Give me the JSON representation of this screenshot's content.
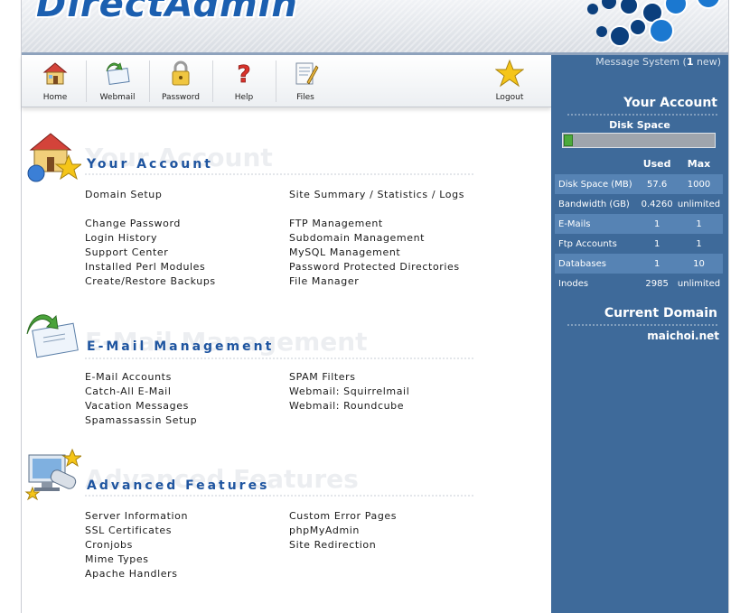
{
  "header": {
    "logo": "DirectAdmin"
  },
  "toolbar": {
    "items": [
      {
        "label": "Home",
        "icon": "home-icon"
      },
      {
        "label": "Webmail",
        "icon": "webmail-icon"
      },
      {
        "label": "Password",
        "icon": "lock-icon"
      },
      {
        "label": "Help",
        "icon": "help-icon"
      },
      {
        "label": "Files",
        "icon": "files-icon"
      },
      {
        "label": "Logout",
        "icon": "star-icon"
      }
    ]
  },
  "sidebar": {
    "message_system": {
      "label": "Message System (",
      "count": "1",
      "suffix": " new)"
    },
    "account_heading": "Your Account",
    "disk_space_label": "Disk Space",
    "disk_usage_fraction": 0.058,
    "columns": {
      "used": "Used",
      "max": "Max"
    },
    "stats": [
      {
        "name": "Disk Space (MB)",
        "used": "57.6",
        "max": "1000"
      },
      {
        "name": "Bandwidth (GB)",
        "used": "0.4260",
        "max": "unlimited"
      },
      {
        "name": "E-Mails",
        "used": "1",
        "max": "1"
      },
      {
        "name": "Ftp Accounts",
        "used": "1",
        "max": "1"
      },
      {
        "name": "Databases",
        "used": "1",
        "max": "10"
      },
      {
        "name": "Inodes",
        "used": "2985",
        "max": "unlimited"
      }
    ],
    "current_domain_heading": "Current Domain",
    "current_domain": "maichoi.net"
  },
  "sections": {
    "account": {
      "title": "Your Account",
      "links_left": [
        "Domain Setup",
        "Change Password",
        "Login History",
        "Support Center",
        "Installed Perl Modules",
        "Create/Restore Backups"
      ],
      "links_right": [
        "Site Summary / Statistics / Logs",
        "FTP Management",
        "Subdomain Management",
        "MySQL Management",
        "Password Protected Directories",
        "File Manager"
      ]
    },
    "email": {
      "title": "E-Mail Management",
      "links_left": [
        "E-Mail Accounts",
        "Catch-All E-Mail",
        "Vacation Messages",
        "Spamassassin Setup"
      ],
      "links_right": [
        "SPAM Filters",
        "Webmail: Squirrelmail",
        "Webmail: Roundcube"
      ]
    },
    "advanced": {
      "title": "Advanced Features",
      "links_left": [
        "Server Information",
        "SSL Certificates",
        "Cronjobs",
        "Mime Types",
        "Apache Handlers"
      ],
      "links_right": [
        "Custom Error Pages",
        "phpMyAdmin",
        "Site Redirection"
      ]
    }
  },
  "colors": {
    "sidebar": "#3e6a9a",
    "accent": "#1f55a0",
    "disk_fill": "#4caa3c"
  }
}
